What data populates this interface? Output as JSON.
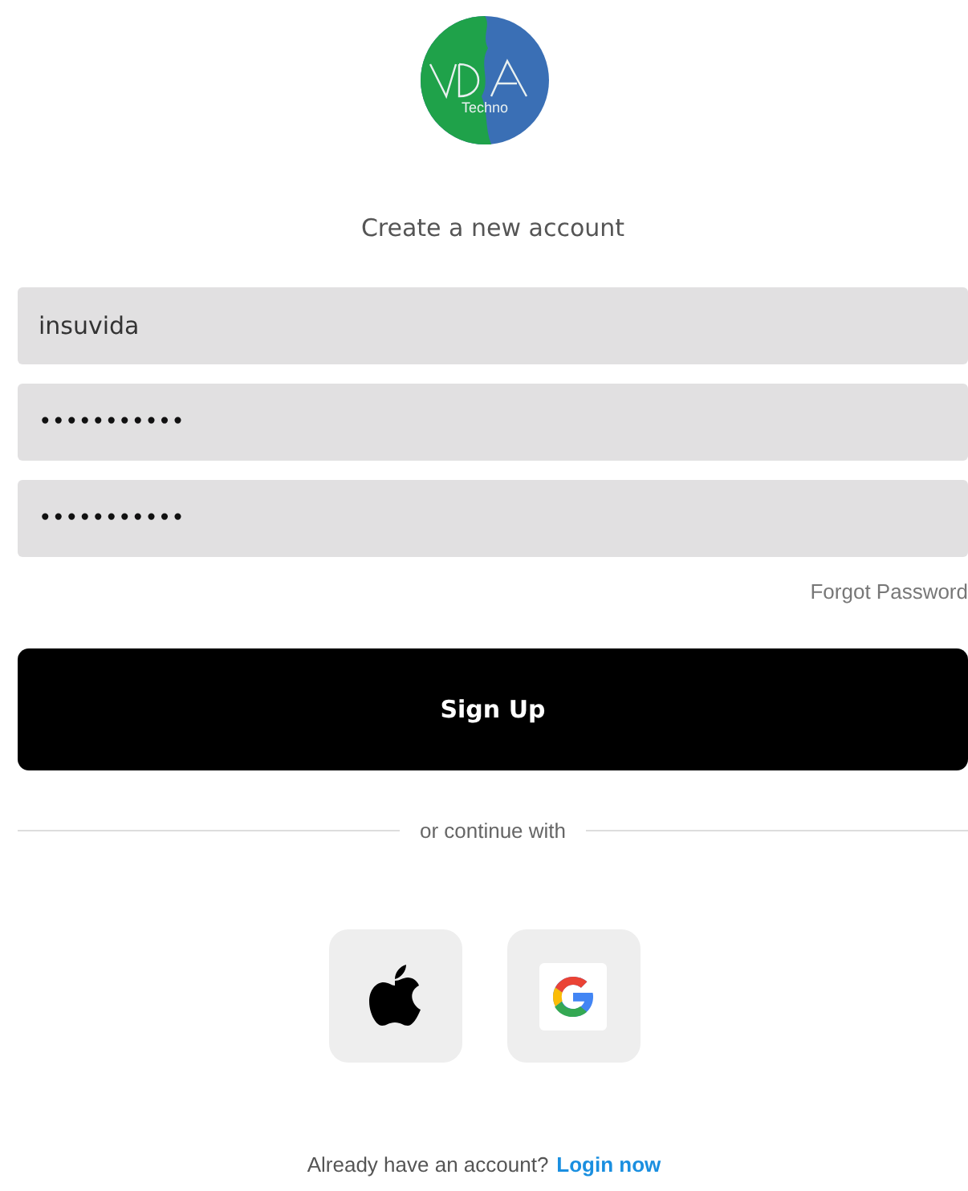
{
  "logo": {
    "text": "Techno"
  },
  "heading": "Create a new account",
  "fields": [
    {
      "kind": "text",
      "value": "insuvida"
    },
    {
      "kind": "password",
      "value": "•••••••••••"
    },
    {
      "kind": "password",
      "value": "•••••••••••"
    }
  ],
  "forgot_link": "Forgot Password",
  "submit_button": "Sign Up",
  "divider_text": "or continue with",
  "social_buttons": [
    {
      "kind": "apple"
    },
    {
      "kind": "google"
    }
  ],
  "footer": {
    "text": "Already have an account?",
    "link": "Login now"
  }
}
